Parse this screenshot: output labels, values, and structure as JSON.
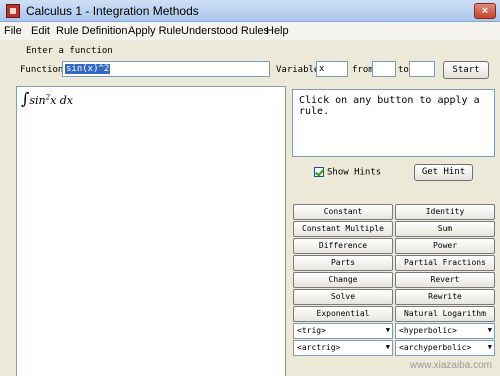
{
  "window": {
    "title": "Calculus 1 - Integration Methods",
    "close_glyph": "×"
  },
  "menu": [
    {
      "label": "File"
    },
    {
      "label": "Edit"
    },
    {
      "label": "Rule Definition"
    },
    {
      "label": "Apply Rule"
    },
    {
      "label": "Understood Rules"
    },
    {
      "label": "Help"
    }
  ],
  "input": {
    "section_label": "Enter a function",
    "function_label": "Function",
    "function_value": "sin(x)^2",
    "variable_label": "Variable",
    "variable_value": "x",
    "from_label": "from",
    "from_value": "",
    "to_label": "to",
    "to_value": "",
    "start_label": "Start"
  },
  "workspace": {
    "integral_sign": "∫",
    "expr_func": "sin",
    "expr_power": "2",
    "expr_rest": "x dx"
  },
  "hints": {
    "message": "Click on any button to apply a rule.",
    "show_hints_label": "Show Hints",
    "show_hints_checked": true,
    "get_hint_label": "Get Hint"
  },
  "rules": [
    {
      "label": "Constant"
    },
    {
      "label": "Identity"
    },
    {
      "label": "Constant Multiple"
    },
    {
      "label": "Sum"
    },
    {
      "label": "Difference"
    },
    {
      "label": "Power"
    },
    {
      "label": "Parts"
    },
    {
      "label": "Partial Fractions"
    },
    {
      "label": "Change"
    },
    {
      "label": "Revert"
    },
    {
      "label": "Solve"
    },
    {
      "label": "Rewrite"
    },
    {
      "label": "Exponential"
    },
    {
      "label": "Natural Logarithm"
    }
  ],
  "dropdowns": [
    {
      "selected": "<trig>"
    },
    {
      "selected": "<hyperbolic>"
    },
    {
      "selected": "<arctrig>"
    },
    {
      "selected": "<archyperbolic>"
    }
  ],
  "watermark": "www.xiazaiba.com"
}
